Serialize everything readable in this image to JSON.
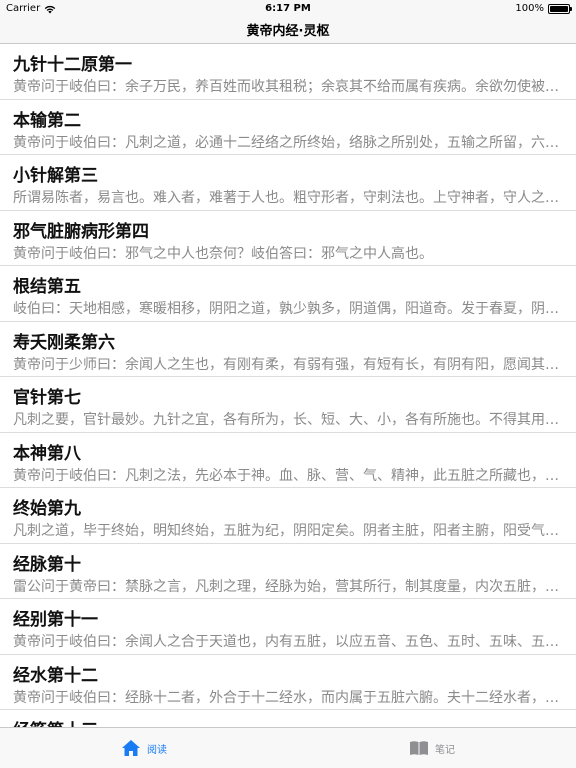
{
  "status_bar": {
    "carrier": "Carrier",
    "time": "6:17 PM",
    "battery": "100%"
  },
  "nav": {
    "title": "黄帝内经·灵枢"
  },
  "chapters": [
    {
      "title": "九针十二原第一",
      "excerpt": "黄帝问于岐伯曰：余子万民，养百姓而收其租税；余哀其不给而属有疾病。余欲勿使被毒药，无用砭石"
    },
    {
      "title": "本输第二",
      "excerpt": "黄帝问于岐伯曰：凡刺之道，必通十二经络之所终始，络脉之所别处，五输之所留，六腑之所与合"
    },
    {
      "title": "小针解第三",
      "excerpt": "所谓易陈者，易言也。难入者，难著于人也。粗守形者，守刺法也。上守神者，守人之血气有余不足"
    },
    {
      "title": "邪气脏腑病形第四",
      "excerpt": "黄帝问于岐伯曰：邪气之中人也奈何？岐伯答曰：邪气之中人高也。"
    },
    {
      "title": "根结第五",
      "excerpt": "岐伯曰：天地相感，寒暖相移，阴阳之道，孰少孰多，阴道偶，阳道奇。发于春夏，阴气少，阳气多"
    },
    {
      "title": "寿夭刚柔第六",
      "excerpt": "黄帝问于少师曰：余闻人之生也，有刚有柔，有弱有强，有短有长，有阴有阳，愿闻其方。"
    },
    {
      "title": "官针第七",
      "excerpt": "凡刺之要，官针最妙。九针之宜，各有所为，长、短、大、小，各有所施也。不得其用，病弗能移"
    },
    {
      "title": "本神第八",
      "excerpt": "黄帝问于岐伯曰：凡刺之法，先必本于神。血、脉、营、气、精神，此五脏之所藏也，至其淫泆离脏则精失"
    },
    {
      "title": "终始第九",
      "excerpt": "凡刺之道，毕于终始，明知终始，五脏为纪，阴阳定矣。阴者主脏，阳者主腑，阳受气于四末，阴受气于五脏"
    },
    {
      "title": "经脉第十",
      "excerpt": "雷公问于黄帝曰：禁脉之言，凡刺之理，经脉为始，营其所行，制其度量，内次五脏，外别六腑"
    },
    {
      "title": "经别第十一",
      "excerpt": "黄帝问于岐伯曰：余闻人之合于天道也，内有五脏，以应五音、五色、五时、五味、五位也"
    },
    {
      "title": "经水第十二",
      "excerpt": "黄帝问于岐伯曰：经脉十二者，外合于十二经水，而内属于五脏六腑。夫十二经水者，其有大小"
    },
    {
      "title": "经筋第十三",
      "excerpt": ""
    }
  ],
  "tabs": [
    {
      "label": "阅读",
      "icon": "home-icon",
      "active": true
    },
    {
      "label": "笔记",
      "icon": "notes-icon",
      "active": false
    }
  ],
  "colors": {
    "accent": "#1a7cf5",
    "inactive": "#8e8e93",
    "excerpt": "#8a8a8a"
  }
}
